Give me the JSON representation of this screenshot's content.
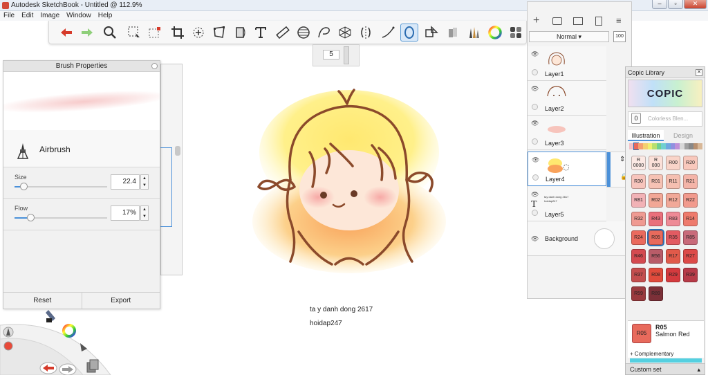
{
  "window": {
    "title": "Autodesk SketchBook - Untitled @ 112.9%"
  },
  "menu": [
    "File",
    "Edit",
    "Image",
    "Window",
    "Help"
  ],
  "toolbar": {
    "tools": [
      "undo-icon",
      "redo-icon",
      "zoom-icon",
      "select-icon",
      "crop-select-icon",
      "crop-icon",
      "transform-icon",
      "distort-icon",
      "perspective-icon",
      "text-icon",
      "ruler-icon",
      "ellipse-icon",
      "french-curve-icon",
      "perspective-grid-icon",
      "symmetry-icon",
      "stroke-icon",
      "predictive-stroke-icon",
      "shapes-icon",
      "copic-icon",
      "brushes-icon",
      "color-wheel-icon",
      "palette-icon"
    ],
    "selected_index": 16
  },
  "brush_size": {
    "value": "5"
  },
  "brush_properties": {
    "title": "Brush Properties",
    "brush_name": "Airbrush",
    "size": {
      "label": "Size",
      "value": "22.4",
      "fraction": 0.1
    },
    "flow": {
      "label": "Flow",
      "value": "17%",
      "fraction": 0.17
    },
    "reset_label": "Reset",
    "export_label": "Export"
  },
  "canvas": {
    "caption_1": "ta y danh dong 2617",
    "caption_2": "hoidap247"
  },
  "layers": {
    "blend_mode": "Normal",
    "opacity": "100",
    "items": [
      {
        "name": "Layer1"
      },
      {
        "name": "Layer2"
      },
      {
        "name": "Layer3"
      },
      {
        "name": "Layer4"
      },
      {
        "name": "Layer5",
        "thumb_text_1": "tay danh dong 2617",
        "thumb_text_2": "hoidap247"
      },
      {
        "name": "Background"
      }
    ],
    "selected_index": 3
  },
  "copic": {
    "title": "Copic Library",
    "logo": "COPIC",
    "colorless_chip": "0",
    "colorless_label": "Colorless Blen...",
    "tabs": [
      "Illustration",
      "Design"
    ],
    "active_tab": "Illustration",
    "swatches": [
      {
        "code": "R\n0000",
        "color": "#fbe9e4"
      },
      {
        "code": "R\n000",
        "color": "#fbe0d8"
      },
      {
        "code": "R00",
        "color": "#f9d4c8"
      },
      {
        "code": "R20",
        "color": "#f8c8bc"
      },
      {
        "code": "R30",
        "color": "#f7c4bc"
      },
      {
        "code": "R01",
        "color": "#f6c2b4"
      },
      {
        "code": "R11",
        "color": "#f5bfb1"
      },
      {
        "code": "R21",
        "color": "#f4b4a8"
      },
      {
        "code": "R81",
        "color": "#f2b2b6"
      },
      {
        "code": "R02",
        "color": "#f2a796"
      },
      {
        "code": "R12",
        "color": "#f1a898"
      },
      {
        "code": "R22",
        "color": "#f19a8d"
      },
      {
        "code": "R32",
        "color": "#ef9a92"
      },
      {
        "code": "R43",
        "color": "#ea6f7b"
      },
      {
        "code": "R83",
        "color": "#ee8a96"
      },
      {
        "code": "R14",
        "color": "#ee7a6c"
      },
      {
        "code": "R24",
        "color": "#ea6a5d"
      },
      {
        "code": "R05",
        "color": "#e86a5c"
      },
      {
        "code": "R35",
        "color": "#e25b62"
      },
      {
        "code": "R85",
        "color": "#c86a7a"
      },
      {
        "code": "R46",
        "color": "#d44a50"
      },
      {
        "code": "R56",
        "color": "#b85c68"
      },
      {
        "code": "R17",
        "color": "#e05a4a"
      },
      {
        "code": "R27",
        "color": "#dc4a48"
      },
      {
        "code": "R37",
        "color": "#c44e4e"
      },
      {
        "code": "R08",
        "color": "#e04b3c"
      },
      {
        "code": "R29",
        "color": "#d43a3e"
      },
      {
        "code": "R39",
        "color": "#b73a48"
      },
      {
        "code": "R59",
        "color": "#9a3a3e"
      },
      {
        "code": "R89",
        "color": "#7c3038"
      }
    ],
    "selected_swatch": "R05",
    "current_code": "R05",
    "current_name": "Salmon Red",
    "complementary_label": "Complementary",
    "complementary_color": "#55d0e0",
    "custom_set_label": "Custom set",
    "strip_colors": [
      "#f3c3c8",
      "#e86a5c",
      "#f4a070",
      "#f4d070",
      "#f0f070",
      "#b8e070",
      "#70d090",
      "#70d0d0",
      "#70a8e0",
      "#9090e0",
      "#c090d8",
      "#d8d8d8",
      "#a0a0a0",
      "#888888",
      "#b89070",
      "#d8b898"
    ]
  }
}
